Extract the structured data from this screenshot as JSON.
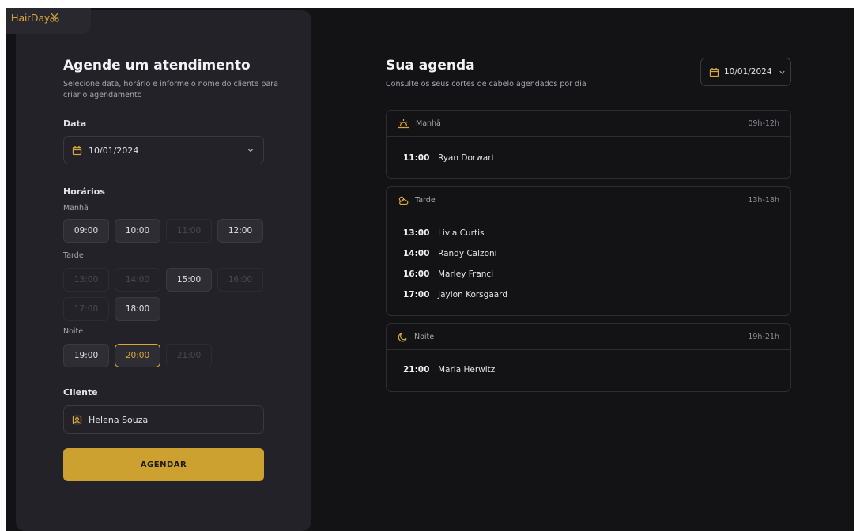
{
  "logo": {
    "text": "HairDay"
  },
  "form": {
    "title": "Agende um atendimento",
    "subtitle_line1": "Selecione data, horário e informe o nome do cliente para",
    "subtitle_line2": "criar o agendamento",
    "date_label": "Data",
    "date_value": "10/01/2024",
    "times_label": "Horários",
    "periods": {
      "morning": "Manhã",
      "afternoon": "Tarde",
      "night": "Noite"
    },
    "slots": {
      "morning": [
        {
          "time": "09:00",
          "state": "available"
        },
        {
          "time": "10:00",
          "state": "available"
        },
        {
          "time": "11:00",
          "state": "unavailable"
        },
        {
          "time": "12:00",
          "state": "available"
        }
      ],
      "afternoon": [
        {
          "time": "13:00",
          "state": "unavailable"
        },
        {
          "time": "14:00",
          "state": "unavailable"
        },
        {
          "time": "15:00",
          "state": "available"
        },
        {
          "time": "16:00",
          "state": "unavailable"
        },
        {
          "time": "17:00",
          "state": "unavailable"
        },
        {
          "time": "18:00",
          "state": "available"
        }
      ],
      "night": [
        {
          "time": "19:00",
          "state": "available"
        },
        {
          "time": "20:00",
          "state": "selected"
        },
        {
          "time": "21:00",
          "state": "unavailable"
        }
      ]
    },
    "client_label": "Cliente",
    "client_value": "Helena Souza",
    "submit_label": "AGENDAR"
  },
  "agenda": {
    "title": "Sua agenda",
    "subtitle": "Consulte os seus cortes de cabelo agendados por dia",
    "date_value": "10/01/2024",
    "sections": {
      "morning": {
        "title": "Manhã",
        "range": "09h-12h",
        "items": [
          {
            "time": "11:00",
            "name": "Ryan Dorwart"
          }
        ]
      },
      "afternoon": {
        "title": "Tarde",
        "range": "13h-18h",
        "items": [
          {
            "time": "13:00",
            "name": "Livia Curtis"
          },
          {
            "time": "14:00",
            "name": "Randy Calzoni"
          },
          {
            "time": "16:00",
            "name": "Marley Franci"
          },
          {
            "time": "17:00",
            "name": "Jaylon Korsgaard"
          }
        ]
      },
      "night": {
        "title": "Noite",
        "range": "19h-21h",
        "items": [
          {
            "time": "21:00",
            "name": "Maria Herwitz"
          }
        ]
      }
    }
  },
  "colors": {
    "accent": "#d9a83a",
    "button": "#cda12f",
    "background": "#131316",
    "panel": "#232228"
  }
}
